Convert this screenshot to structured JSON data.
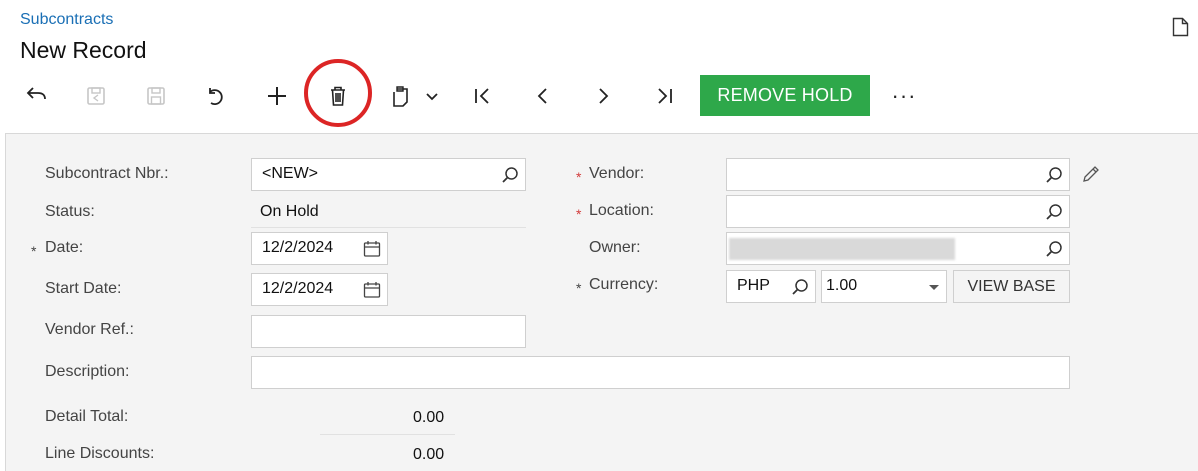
{
  "breadcrumb": "Subcontracts",
  "title": "New Record",
  "toolbar": {
    "icons": [
      "back-arrow-icon",
      "save-close-icon",
      "save-icon",
      "undo-icon",
      "add-icon",
      "delete-icon",
      "copy-paste-icon",
      "first-record-icon",
      "prev-record-icon",
      "next-record-icon",
      "last-record-icon",
      "more-icon"
    ],
    "remove_hold_label": "REMOVE HOLD",
    "more_label": "···",
    "highlight_color": "#dc2525",
    "accent_color": "#2ea84a"
  },
  "form": {
    "subcontract_nbr_label": "Subcontract Nbr.:",
    "subcontract_nbr_value": "<NEW>",
    "status_label": "Status:",
    "status_value": "On Hold",
    "date_label": "Date:",
    "date_value": "12/2/2024",
    "start_date_label": "Start Date:",
    "start_date_value": "12/2/2024",
    "vendor_ref_label": "Vendor Ref.:",
    "vendor_ref_value": "",
    "description_label": "Description:",
    "description_value": "",
    "detail_total_label": "Detail Total:",
    "detail_total_value": "0.00",
    "line_discounts_label": "Line Discounts:",
    "line_discounts_value": "0.00",
    "vendor_label": "Vendor:",
    "vendor_value": "",
    "location_label": "Location:",
    "location_value": "",
    "owner_label": "Owner:",
    "currency_label": "Currency:",
    "currency_value": "PHP",
    "rate_value": "1.00",
    "view_base_label": "VIEW BASE",
    "required_mark": "*"
  }
}
